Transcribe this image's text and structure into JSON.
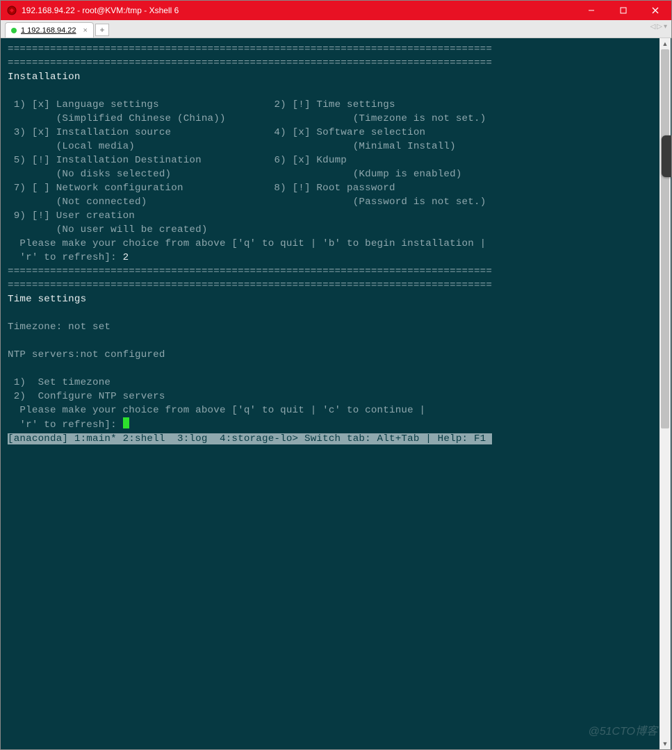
{
  "titlebar": {
    "text": "192.168.94.22 - root@KVM:/tmp - Xshell 6"
  },
  "tab": {
    "label": "1 192.168.94.22"
  },
  "term": {
    "divider": "================================================================================",
    "divider2": "================================================================================",
    "heading": "Installation",
    "opt1_l": " 1) [x] Language settings",
    "opt1_s": "        (Simplified Chinese (China))",
    "opt2_l": "2) [!] Time settings",
    "opt2_s": "       (Timezone is not set.)",
    "opt3_l": " 3) [x] Installation source",
    "opt3_s": "        (Local media)",
    "opt4_l": "4) [x] Software selection",
    "opt4_s": "       (Minimal Install)",
    "opt5_l": " 5) [!] Installation Destination",
    "opt5_s": "        (No disks selected)",
    "opt6_l": "6) [x] Kdump",
    "opt6_s": "       (Kdump is enabled)",
    "opt7_l": " 7) [ ] Network configuration",
    "opt7_s": "        (Not connected)",
    "opt8_l": "8) [!] Root password",
    "opt8_s": "       (Password is not set.)",
    "opt9_l": " 9) [!] User creation",
    "opt9_s": "        (No user will be created)",
    "prompt1a": "  Please make your choice from above ['q' to quit | 'b' to begin installation |",
    "prompt1b": "  'r' to refresh]: ",
    "input1": "2",
    "ts_head": "Time settings",
    "tz": "Timezone: not set",
    "ntp": "NTP servers:not configured",
    "ts1": " 1)  Set timezone",
    "ts2": " 2)  Configure NTP servers",
    "prompt2a": "  Please make your choice from above ['q' to quit | 'c' to continue |",
    "prompt2b": "  'r' to refresh]: ",
    "status": "[anaconda] 1:main* 2:shell  3:log  4:storage-lo> Switch tab: Alt+Tab | Help: F1 "
  },
  "watermark": "@51CTO博客"
}
